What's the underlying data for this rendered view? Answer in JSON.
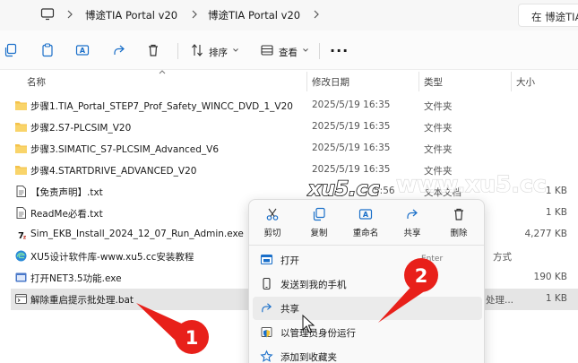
{
  "address_bar": {
    "crumbs": [
      "博途TIA Portal v20",
      "博途TIA Portal v20"
    ],
    "search_placeholder": "在 博途TIA"
  },
  "toolbar": {
    "sort_label": "排序",
    "view_label": "查看",
    "more_label": "···"
  },
  "columns": {
    "name": "名称",
    "modified": "修改日期",
    "type": "类型",
    "size": "大小"
  },
  "files": [
    {
      "name": "步骤1.TIA_Portal_STEP7_Prof_Safety_WINCC_DVD_1_V20",
      "date": "2025/5/19 16:35",
      "type": "文件夹",
      "size": "",
      "icon": "folder-icon"
    },
    {
      "name": "步骤2.S7-PLCSIM_V20",
      "date": "2025/5/19 16:35",
      "type": "文件夹",
      "size": "",
      "icon": "folder-icon"
    },
    {
      "name": "步骤3.SIMATIC_S7-PLCSIM_Advanced_V6",
      "date": "2025/5/19 16:35",
      "type": "文件夹",
      "size": "",
      "icon": "folder-icon"
    },
    {
      "name": "步骤4.STARTDRIVE_ADVANCED_V20",
      "date": "2025/5/19 16:35",
      "type": "文件夹",
      "size": "",
      "icon": "folder-icon"
    },
    {
      "name": "【免责声明】.txt",
      "date": "5:56",
      "type": "文本文档",
      "size": "1 KB",
      "icon": "text-file-icon"
    },
    {
      "name": "ReadMe必看.txt",
      "date": "",
      "type": "",
      "size": "1 KB",
      "icon": "text-file-icon"
    },
    {
      "name": "Sim_EKB_Install_2024_12_07_Run_Admin.exe",
      "date": "",
      "type": "",
      "size": "4,277 KB",
      "icon": "exe-7z-icon"
    },
    {
      "name": "XU5设计软件库-www.xu5.cc安装教程",
      "date": "",
      "type": "方式",
      "size": "",
      "icon": "shortcut-edge-icon"
    },
    {
      "name": "打开NET3.5功能.exe",
      "date": "",
      "type": "",
      "size": "190 KB",
      "icon": "exe-app-icon"
    },
    {
      "name": "解除重启提示批处理.bat",
      "date": "",
      "type": "处理...",
      "size": "1 KB",
      "icon": "bat-file-icon"
    }
  ],
  "watermark": {
    "left": "xu5.cc",
    "right": "www.xu5.cc"
  },
  "context_menu": {
    "quick_actions": [
      {
        "label": "剪切",
        "icon": "cut-icon"
      },
      {
        "label": "复制",
        "icon": "copy-icon"
      },
      {
        "label": "重命名",
        "icon": "rename-icon"
      },
      {
        "label": "共享",
        "icon": "share-icon"
      },
      {
        "label": "删除",
        "icon": "delete-icon"
      }
    ],
    "items": [
      {
        "label": "打开",
        "shortcut": "Enter",
        "icon": "open-icon"
      },
      {
        "label": "发送到我的手机",
        "shortcut": "",
        "icon": "phone-icon"
      },
      {
        "label": "共享",
        "shortcut": "",
        "icon": "share-icon"
      },
      {
        "label": "以管理员身份运行",
        "shortcut": "",
        "icon": "admin-shield-icon"
      },
      {
        "label": "添加到收藏夹",
        "shortcut": "",
        "icon": "star-icon"
      }
    ]
  },
  "annotations": {
    "marker_1": "1",
    "marker_2": "2",
    "color": "#e8201a"
  }
}
